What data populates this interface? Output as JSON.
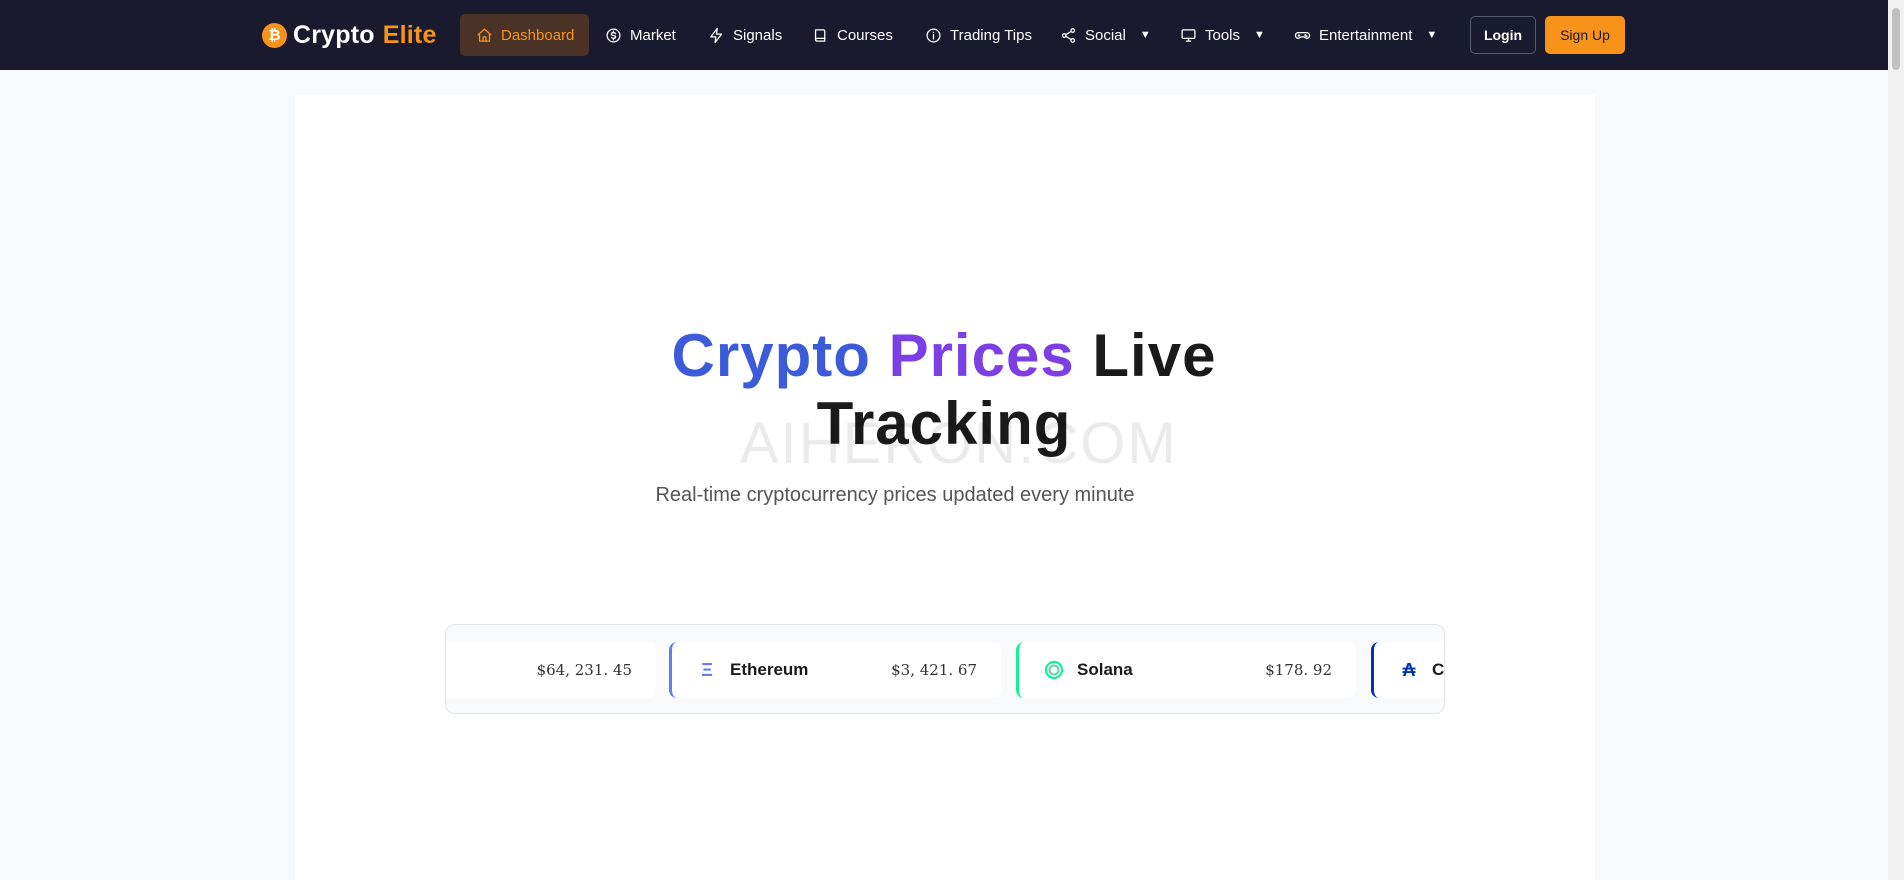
{
  "brand": {
    "coin_glyph": "₿",
    "name": "Crypto",
    "accent": "Elite",
    "accent_color": "#f7931a"
  },
  "nav": {
    "items": [
      {
        "label": "Dashboard",
        "icon": "home-icon",
        "active": true
      },
      {
        "label": "Market",
        "icon": "dollar-circle-icon"
      },
      {
        "label": "Signals",
        "icon": "bolt-icon"
      },
      {
        "label": "Courses",
        "icon": "book-icon"
      },
      {
        "label": "Trading Tips",
        "icon": "info-circle-icon"
      },
      {
        "label": "Social",
        "icon": "share-icon",
        "dropdown": true
      },
      {
        "label": "Tools",
        "icon": "monitor-icon",
        "dropdown": true
      },
      {
        "label": "Entertainment",
        "icon": "gamepad-icon",
        "dropdown": true
      }
    ],
    "caret": "▼",
    "login": "Login",
    "signup": "Sign Up"
  },
  "hero": {
    "title_part1": "Crypto",
    "title_part2": "Prices",
    "title_part3": "Live",
    "title_line2": "Tracking",
    "subtitle": "Real-time cryptocurrency prices updated every minute",
    "watermark": "AIHERON.COM"
  },
  "ticker": [
    {
      "name": "",
      "price": "$64, 231. 45",
      "icon": "",
      "color": "#f7931a"
    },
    {
      "name": "Ethereum",
      "price": "$3, 421. 67",
      "icon": "ethereum-icon",
      "glyph": "Ξ",
      "color": "#627eea"
    },
    {
      "name": "Solana",
      "price": "$178. 92",
      "icon": "solana-icon",
      "color": "#14f195"
    },
    {
      "name": "Ca",
      "price": "",
      "icon": "cardano-icon",
      "glyph": "₳",
      "color": "#0033ad"
    }
  ],
  "colors": {
    "navbar": "#1a1a2e",
    "accent": "#f7931a",
    "title_blue": "#3b5bdb",
    "title_purple": "#7b3fe4"
  }
}
